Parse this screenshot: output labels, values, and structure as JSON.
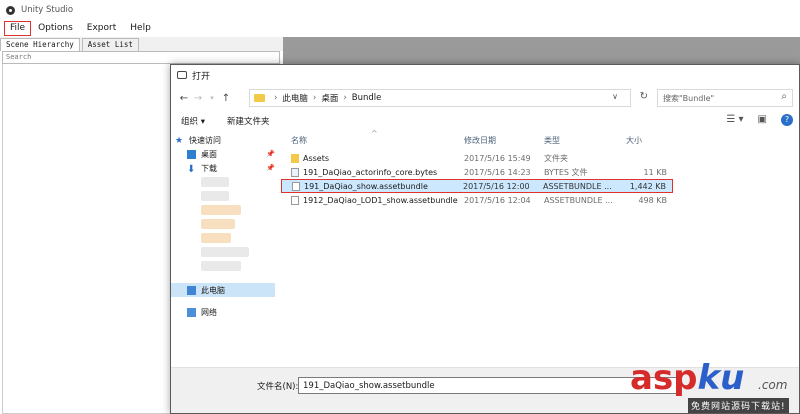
{
  "app": {
    "title": "Unity Studio"
  },
  "menu": {
    "file": "File",
    "options": "Options",
    "export": "Export",
    "help": "Help"
  },
  "left_tabs": {
    "scene_hierarchy": "Scene Hierarchy",
    "asset_list": "Asset List"
  },
  "search_placeholder": "Search",
  "dialog": {
    "title": "打开",
    "breadcrumb": [
      "此电脑",
      "桌面",
      "Bundle"
    ],
    "search_placeholder": "搜索\"Bundle\"",
    "toolbar": {
      "organize": "组织 ▾",
      "new_folder": "新建文件夹"
    },
    "nav": {
      "quick_access": "快速访问",
      "desktop": "桌面",
      "downloads": "下载",
      "this_pc": "此电脑",
      "network": "网络"
    },
    "columns": {
      "name": "名称",
      "date": "修改日期",
      "type": "类型",
      "size": "大小"
    },
    "files": [
      {
        "name": "Assets",
        "date": "2017/5/16 15:49",
        "type": "文件夹",
        "size": "",
        "kind": "folder"
      },
      {
        "name": "191_DaQiao_actorinfo_core.bytes",
        "date": "2017/5/16 14:23",
        "type": "BYTES 文件",
        "size": "11 KB",
        "kind": "file"
      },
      {
        "name": "191_DaQiao_show.assetbundle",
        "date": "2017/5/16 12:00",
        "type": "ASSETBUNDLE ...",
        "size": "1,442 KB",
        "kind": "file",
        "selected": true
      },
      {
        "name": "1912_DaQiao_LOD1_show.assetbundle",
        "date": "2017/5/16 12:04",
        "type": "ASSETBUNDLE ...",
        "size": "498 KB",
        "kind": "file"
      }
    ],
    "filename_label": "文件名(N):",
    "filename_value": "191_DaQiao_show.assetbundle"
  },
  "watermark": {
    "asp": "asp",
    "ku": "ku",
    "com": ".com",
    "sub": "免费网站源码下载站!"
  },
  "colors": {
    "highlight_border": "#e03030",
    "selection": "#cce8ff",
    "viewer_bg": "#9a9a9a"
  }
}
